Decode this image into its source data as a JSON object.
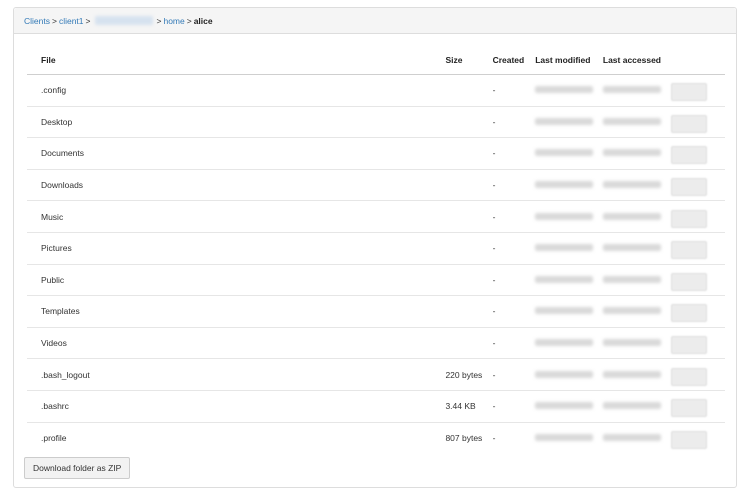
{
  "breadcrumb": {
    "items": [
      {
        "label": "Clients",
        "link": true
      },
      {
        "label": "client1",
        "link": true
      },
      {
        "label": "",
        "link": true,
        "redacted": true
      },
      {
        "label": "home",
        "link": true
      },
      {
        "label": "alice",
        "link": false
      }
    ],
    "separator": ">"
  },
  "table": {
    "columns": [
      "File",
      "Size",
      "Created",
      "Last modified",
      "Last accessed",
      ""
    ],
    "rows": [
      {
        "name": ".config",
        "size": "",
        "created": "-"
      },
      {
        "name": "Desktop",
        "size": "",
        "created": "-"
      },
      {
        "name": "Documents",
        "size": "",
        "created": "-"
      },
      {
        "name": "Downloads",
        "size": "",
        "created": "-"
      },
      {
        "name": "Music",
        "size": "",
        "created": "-"
      },
      {
        "name": "Pictures",
        "size": "",
        "created": "-"
      },
      {
        "name": "Public",
        "size": "",
        "created": "-"
      },
      {
        "name": "Templates",
        "size": "",
        "created": "-"
      },
      {
        "name": "Videos",
        "size": "",
        "created": "-"
      },
      {
        "name": ".bash_logout",
        "size": "220 bytes",
        "created": "-"
      },
      {
        "name": ".bashrc",
        "size": "3.44 KB",
        "created": "-"
      },
      {
        "name": ".profile",
        "size": "807 bytes",
        "created": "-"
      }
    ]
  },
  "download_zip_label": "Download folder as ZIP",
  "colors": {
    "link": "#337ab7",
    "heading_bg": "#f5f5f5",
    "border": "#dddddd"
  }
}
